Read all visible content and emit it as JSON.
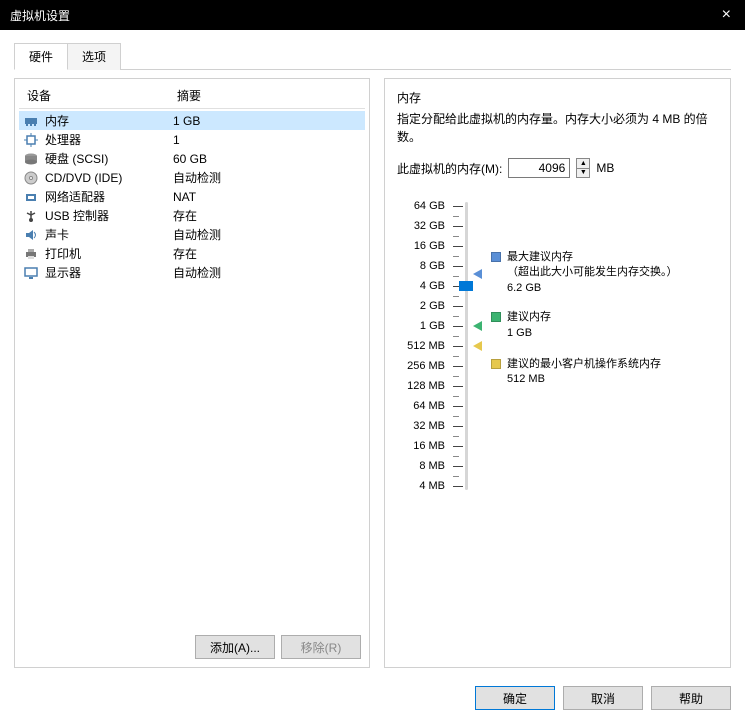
{
  "window": {
    "title": "虚拟机设置",
    "close": "×"
  },
  "tabs": {
    "hardware": "硬件",
    "options": "选项"
  },
  "columns": {
    "device": "设备",
    "summary": "摘要"
  },
  "devices": [
    {
      "icon": "memory-icon",
      "name": "内存",
      "summary": "1 GB",
      "selected": true
    },
    {
      "icon": "cpu-icon",
      "name": "处理器",
      "summary": "1"
    },
    {
      "icon": "disk-icon",
      "name": "硬盘 (SCSI)",
      "summary": "60 GB"
    },
    {
      "icon": "cd-icon",
      "name": "CD/DVD (IDE)",
      "summary": "自动检测"
    },
    {
      "icon": "nic-icon",
      "name": "网络适配器",
      "summary": "NAT"
    },
    {
      "icon": "usb-icon",
      "name": "USB 控制器",
      "summary": "存在"
    },
    {
      "icon": "sound-icon",
      "name": "声卡",
      "summary": "自动检测"
    },
    {
      "icon": "printer-icon",
      "name": "打印机",
      "summary": "存在"
    },
    {
      "icon": "display-icon",
      "name": "显示器",
      "summary": "自动检测"
    }
  ],
  "left_buttons": {
    "add": "添加(A)...",
    "remove": "移除(R)"
  },
  "memory": {
    "title": "内存",
    "desc": "指定分配给此虚拟机的内存量。内存大小必须为 4 MB 的倍数。",
    "label": "此虚拟机的内存(M):",
    "value": "4096",
    "unit": "MB",
    "ticks": [
      "64 GB",
      "32 GB",
      "16 GB",
      "8 GB",
      "4 GB",
      "2 GB",
      "1 GB",
      "512 MB",
      "256 MB",
      "128 MB",
      "64 MB",
      "32 MB",
      "16 MB",
      "8 MB",
      "4 MB"
    ],
    "legend": {
      "max": {
        "label": "最大建议内存",
        "note": "（超出此大小可能发生内存交换。）",
        "value": "6.2 GB",
        "color": "#5a8fd6"
      },
      "rec": {
        "label": "建议内存",
        "value": "1 GB",
        "color": "#3cb371"
      },
      "min": {
        "label": "建议的最小客户机操作系统内存",
        "value": "512 MB",
        "color": "#e6c84d"
      }
    }
  },
  "dialog_buttons": {
    "ok": "确定",
    "cancel": "取消",
    "help": "帮助"
  }
}
